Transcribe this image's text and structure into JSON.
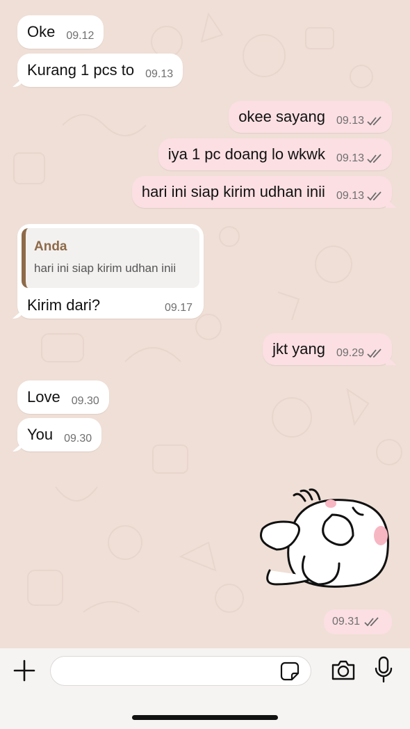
{
  "messages": [
    {
      "text": "Oke",
      "time": "09.12"
    },
    {
      "text": "Kurang 1 pcs to",
      "time": "09.13"
    },
    {
      "text": "okee sayang",
      "time": "09.13"
    },
    {
      "text": "iya 1 pc doang lo wkwk",
      "time": "09.13"
    },
    {
      "text": "hari ini siap kirim udhan inii",
      "time": "09.13"
    },
    {
      "text": "jkt yang",
      "time": "09.29"
    },
    {
      "text": "Love",
      "time": "09.30"
    },
    {
      "text": "You",
      "time": "09.30"
    }
  ],
  "reply": {
    "quoted_author": "Anda",
    "quoted_text": "hari ini siap kirim udhan inii",
    "text": "Kirim dari?",
    "time": "09.17"
  },
  "sticker": {
    "time": "09.31"
  },
  "input": {
    "placeholder": ""
  },
  "icons": {
    "plus": "plus-icon",
    "sticker": "sticker-icon",
    "camera": "camera-icon",
    "mic": "microphone-icon",
    "read_receipt": "double-check-icon"
  },
  "colors": {
    "chat_background": "#efdfd6",
    "incoming_bubble": "#ffffff",
    "outgoing_bubble": "#fbdfe3",
    "quote_accent": "#8e6a48"
  }
}
